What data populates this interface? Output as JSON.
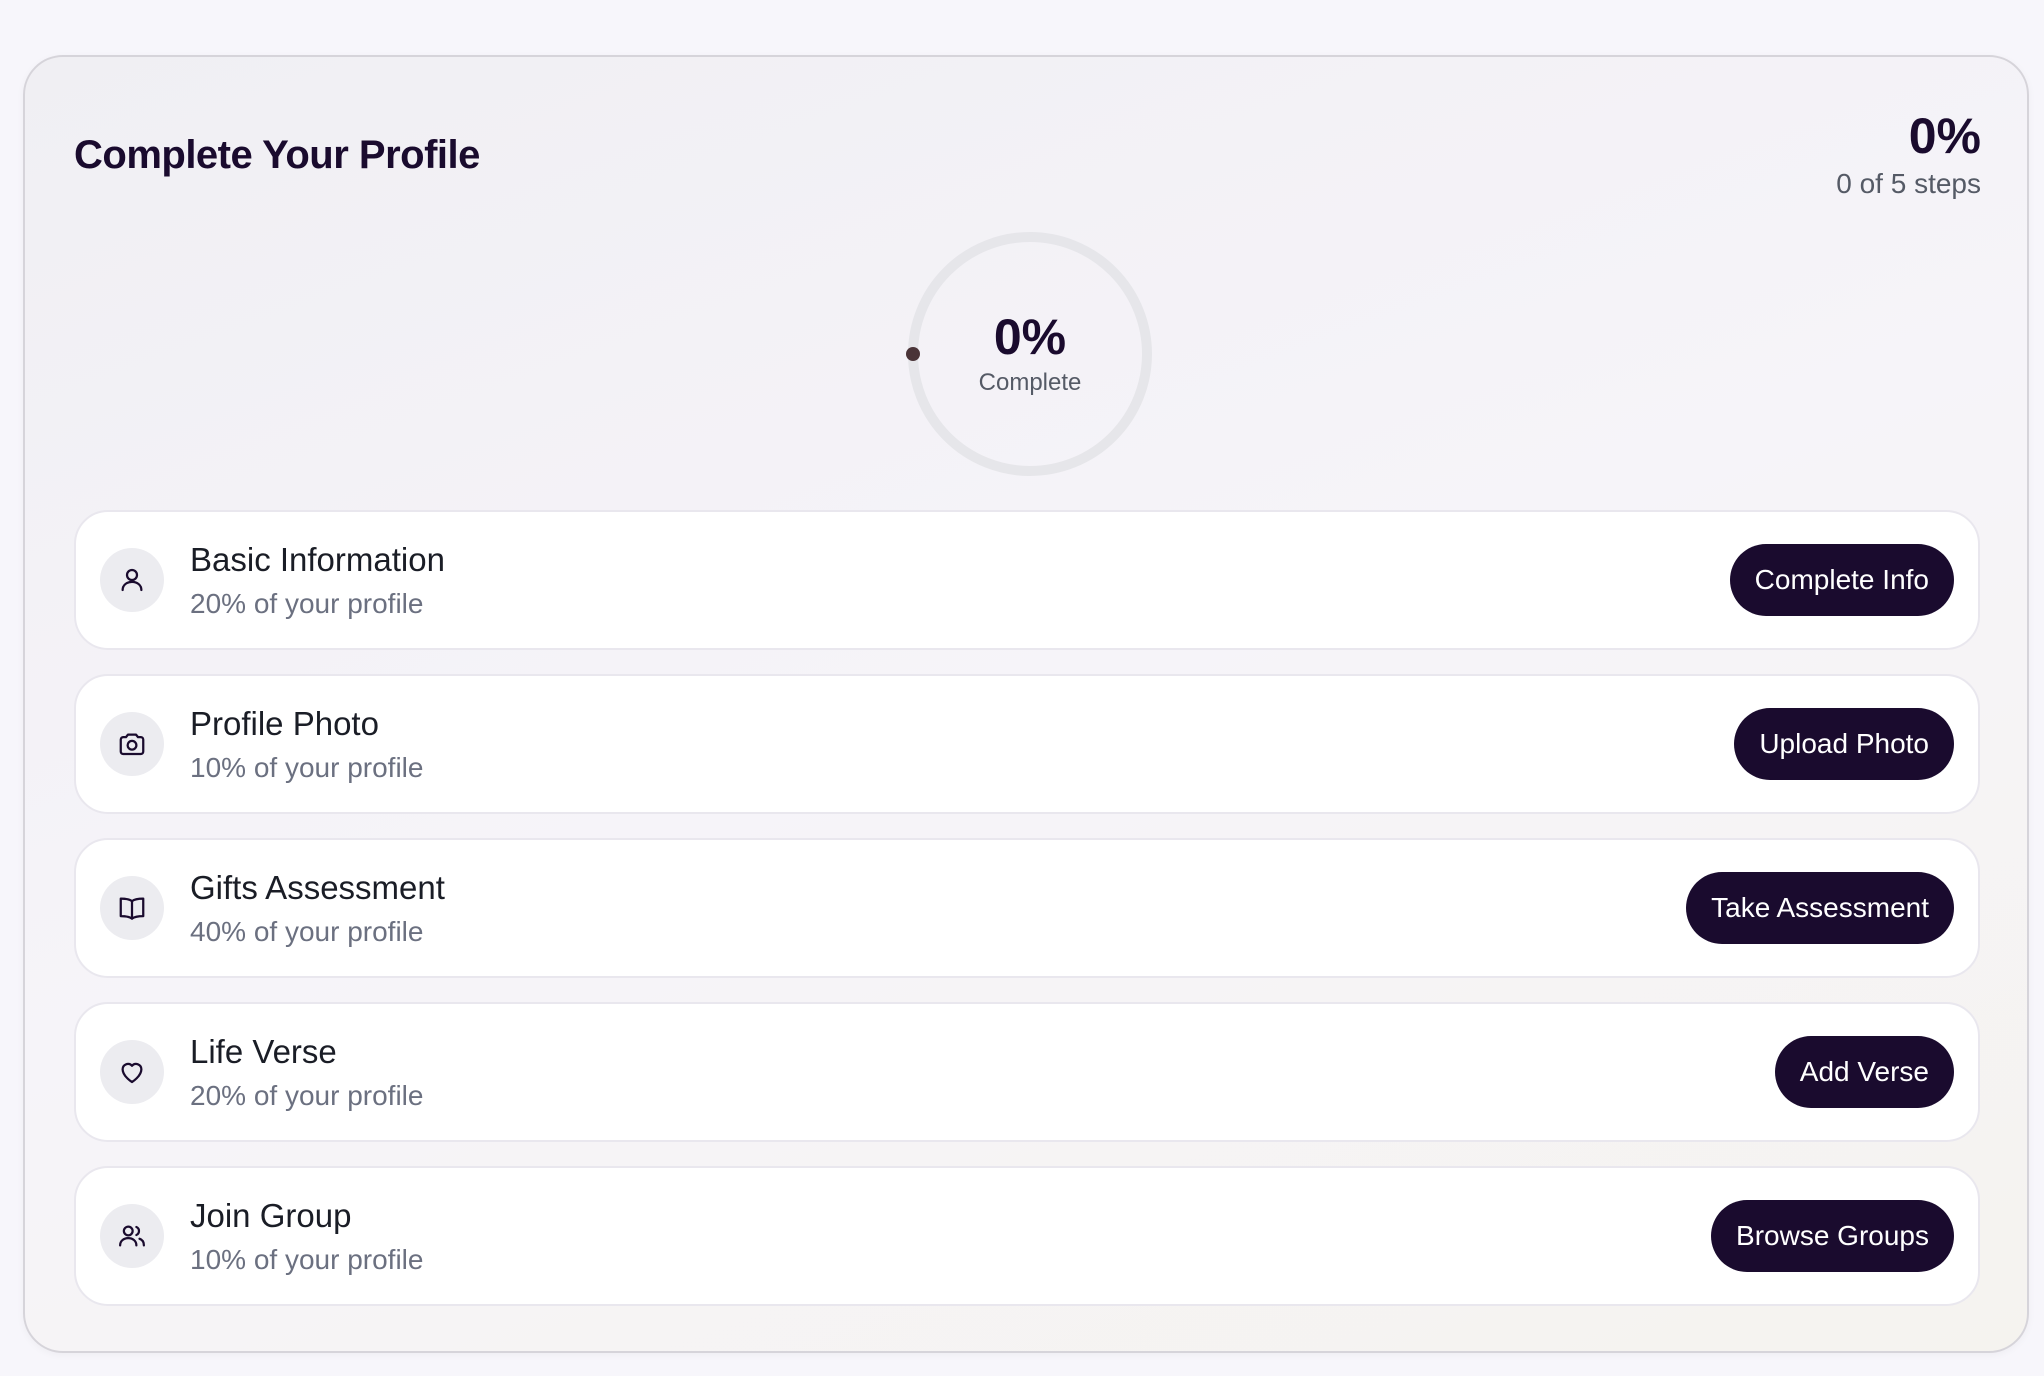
{
  "title": "Complete Your Profile",
  "summary": {
    "percent": "0%",
    "steps": "0 of 5 steps"
  },
  "progress": {
    "value": 0,
    "percent_label": "0%",
    "label": "Complete"
  },
  "colors": {
    "primary": "#1a0b2e",
    "ring_track": "#e6e6ea",
    "ring_dot": "#4a3438",
    "icon_bg": "#ececf0"
  },
  "steps": [
    {
      "icon": "user-icon",
      "title": "Basic Information",
      "subtitle": "20% of your profile",
      "button": "Complete Info"
    },
    {
      "icon": "camera-icon",
      "title": "Profile Photo",
      "subtitle": "10% of your profile",
      "button": "Upload Photo"
    },
    {
      "icon": "book-icon",
      "title": "Gifts Assessment",
      "subtitle": "40% of your profile",
      "button": "Take Assessment"
    },
    {
      "icon": "heart-icon",
      "title": "Life Verse",
      "subtitle": "20% of your profile",
      "button": "Add Verse"
    },
    {
      "icon": "users-icon",
      "title": "Join Group",
      "subtitle": "10% of your profile",
      "button": "Browse Groups"
    }
  ]
}
